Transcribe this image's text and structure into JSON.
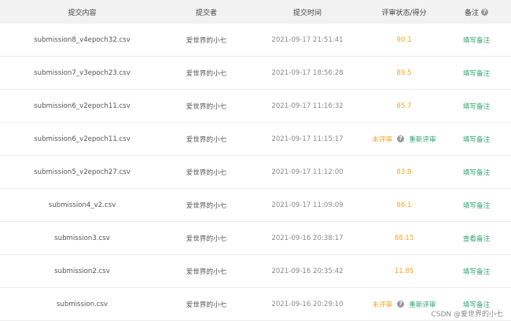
{
  "header": {
    "content": "提交内容",
    "submitter": "提交者",
    "time": "提交时间",
    "status": "评审状态/得分",
    "note": "备注",
    "note_icon": "question-icon"
  },
  "rows": [
    {
      "file": "submission8_v4epoch32.csv",
      "user": "爱世界的小七",
      "time": "2021-09-17 21:51:41",
      "score": "90.1",
      "pending": false,
      "note": "填写备注"
    },
    {
      "file": "submission7_v3epoch23.csv",
      "user": "爱世界的小七",
      "time": "2021-09-17 18:56:28",
      "score": "89.5",
      "pending": false,
      "note": "填写备注"
    },
    {
      "file": "submission6_v2epoch11.csv",
      "user": "爱世界的小七",
      "time": "2021-09-17 11:16:32",
      "score": "85.7",
      "pending": false,
      "note": "填写备注"
    },
    {
      "file": "submission6_v2epoch11.csv",
      "user": "爱世界的小七",
      "time": "2021-09-17 11:15:17",
      "status_label": "未评审",
      "reeval": "重新评审",
      "pending": true,
      "note": "填写备注"
    },
    {
      "file": "submission5_v2epoch27.csv",
      "user": "爱世界的小七",
      "time": "2021-09-17 11:12:00",
      "score": "83.9",
      "pending": false,
      "note": "填写备注"
    },
    {
      "file": "submission4_v2.csv",
      "user": "爱世界的小七",
      "time": "2021-09-17 11:09:09",
      "score": "86.1",
      "pending": false,
      "note": "填写备注"
    },
    {
      "file": "submission3.csv",
      "user": "爱世界的小七",
      "time": "2021-09-16 20:38:17",
      "score": "88.15",
      "pending": false,
      "note": "查看备注"
    },
    {
      "file": "submission2.csv",
      "user": "爱世界的小七",
      "time": "2021-09-16 20:35:42",
      "score": "11.85",
      "pending": false,
      "note": "填写备注"
    },
    {
      "file": "submission.csv",
      "user": "爱世界的小七",
      "time": "2021-09-16 20:29:10",
      "status_label": "未评审",
      "reeval": "重新评审",
      "pending": true,
      "note": "填写备注"
    }
  ],
  "watermark": "CSDN @爱世界的小七",
  "colors": {
    "score": "#f5a623",
    "link": "#2fa56c",
    "header_bg": "#f2f2f2"
  }
}
